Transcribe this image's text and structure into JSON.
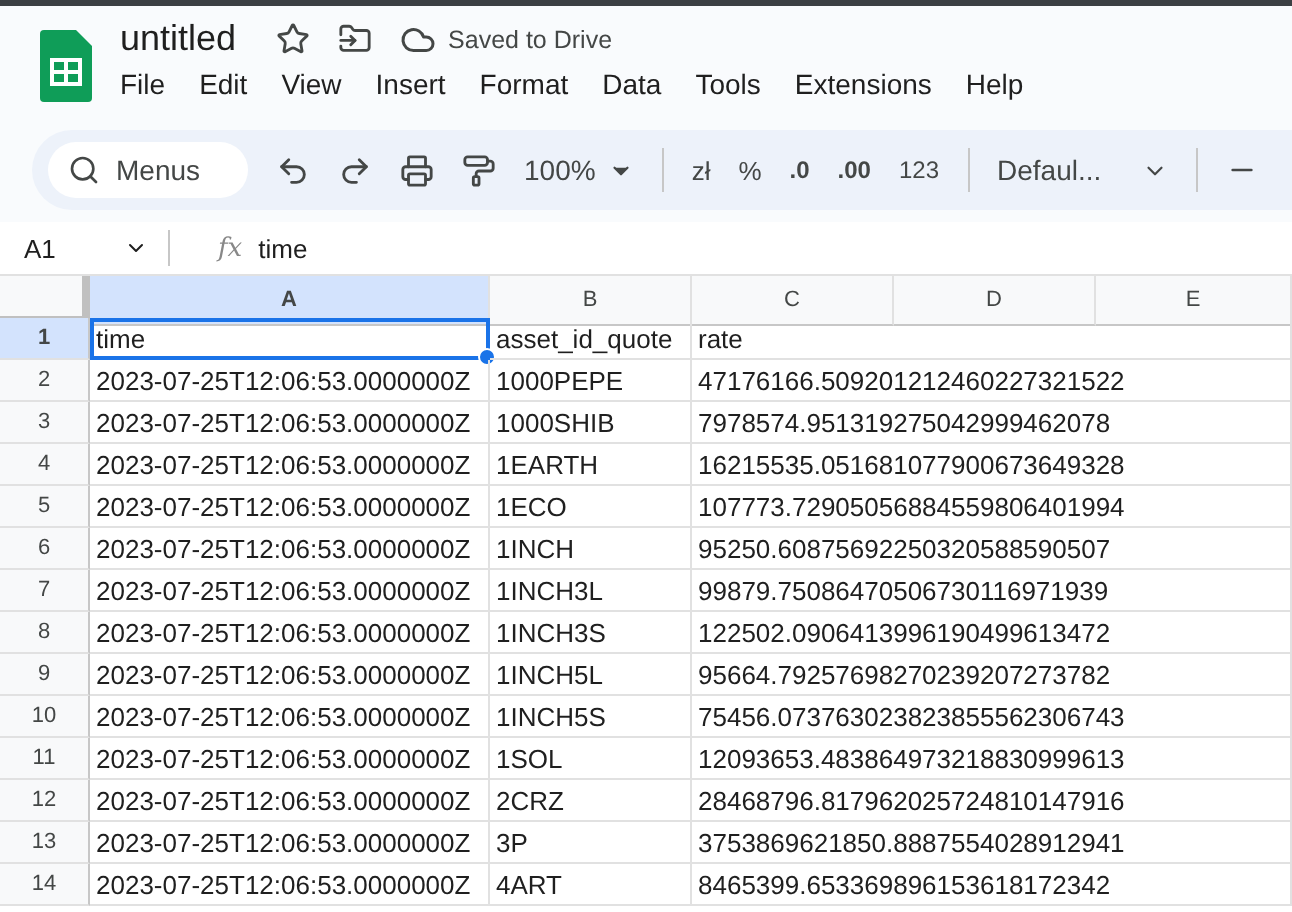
{
  "document": {
    "title": "untitled",
    "save_status": "Saved to Drive"
  },
  "menu": [
    "File",
    "Edit",
    "View",
    "Insert",
    "Format",
    "Data",
    "Tools",
    "Extensions",
    "Help"
  ],
  "toolbar": {
    "search": {
      "placeholder": "Menus"
    },
    "zoom": "100%",
    "currency": "zł",
    "percent": "%",
    "decrease_decimals": ".0",
    "increase_decimals": ".00",
    "number_format": "123",
    "font": "Defaul..."
  },
  "formula_bar": {
    "cell_ref": "A1",
    "function_label": "fx",
    "content": "time"
  },
  "columns": [
    {
      "label": "A",
      "selected": true
    },
    {
      "label": "B",
      "selected": false
    },
    {
      "label": "C",
      "selected": false
    },
    {
      "label": "D",
      "selected": false
    },
    {
      "label": "E",
      "selected": false
    }
  ],
  "rows": [
    {
      "number": "1",
      "selected": true,
      "cells": [
        "time",
        "asset_id_quote",
        "rate"
      ]
    },
    {
      "number": "2",
      "selected": false,
      "cells": [
        "2023-07-25T12:06:53.0000000Z",
        "1000PEPE",
        "47176166.509201212460227321522"
      ]
    },
    {
      "number": "3",
      "selected": false,
      "cells": [
        "2023-07-25T12:06:53.0000000Z",
        "1000SHIB",
        "7978574.951319275042999462078"
      ]
    },
    {
      "number": "4",
      "selected": false,
      "cells": [
        "2023-07-25T12:06:53.0000000Z",
        "1EARTH",
        "16215535.051681077900673649328"
      ]
    },
    {
      "number": "5",
      "selected": false,
      "cells": [
        "2023-07-25T12:06:53.0000000Z",
        "1ECO",
        "107773.72905056884559806401994"
      ]
    },
    {
      "number": "6",
      "selected": false,
      "cells": [
        "2023-07-25T12:06:53.0000000Z",
        "1INCH",
        "95250.60875692250320588590507"
      ]
    },
    {
      "number": "7",
      "selected": false,
      "cells": [
        "2023-07-25T12:06:53.0000000Z",
        "1INCH3L",
        "99879.75086470506730116971939"
      ]
    },
    {
      "number": "8",
      "selected": false,
      "cells": [
        "2023-07-25T12:06:53.0000000Z",
        "1INCH3S",
        "122502.0906413996190499613472"
      ]
    },
    {
      "number": "9",
      "selected": false,
      "cells": [
        "2023-07-25T12:06:53.0000000Z",
        "1INCH5L",
        "95664.79257698270239207273782"
      ]
    },
    {
      "number": "10",
      "selected": false,
      "cells": [
        "2023-07-25T12:06:53.0000000Z",
        "1INCH5S",
        "75456.073763023823855562306743"
      ]
    },
    {
      "number": "11",
      "selected": false,
      "cells": [
        "2023-07-25T12:06:53.0000000Z",
        "1SOL",
        "12093653.483864973218830999613"
      ]
    },
    {
      "number": "12",
      "selected": false,
      "cells": [
        "2023-07-25T12:06:53.0000000Z",
        "2CRZ",
        "28468796.817962025724810147916"
      ]
    },
    {
      "number": "13",
      "selected": false,
      "cells": [
        "2023-07-25T12:06:53.0000000Z",
        "3P",
        "3753869621850.8887554028912941"
      ]
    },
    {
      "number": "14",
      "selected": false,
      "cells": [
        "2023-07-25T12:06:53.0000000Z",
        "4ART",
        "8465399.653369896153618172342"
      ]
    }
  ]
}
